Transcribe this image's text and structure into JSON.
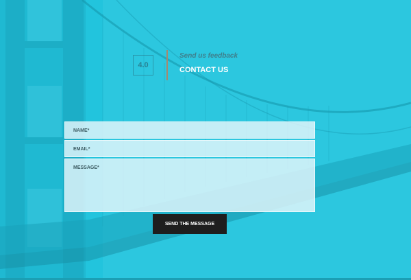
{
  "colors": {
    "background": "#22c4dd",
    "accent_divider": "#a7886e",
    "button_bg": "#1e1e1e",
    "button_text": "#ffffff",
    "field_bg": "#e5f7fb"
  },
  "section": {
    "number": "4.0",
    "subtitle": "Send us feedback",
    "title": "CONTACT US"
  },
  "form": {
    "name_label": "NAME*",
    "email_label": "EMAIL*",
    "message_label": "MESSAGE*",
    "submit_label": "SEND THE MESSAGE"
  }
}
